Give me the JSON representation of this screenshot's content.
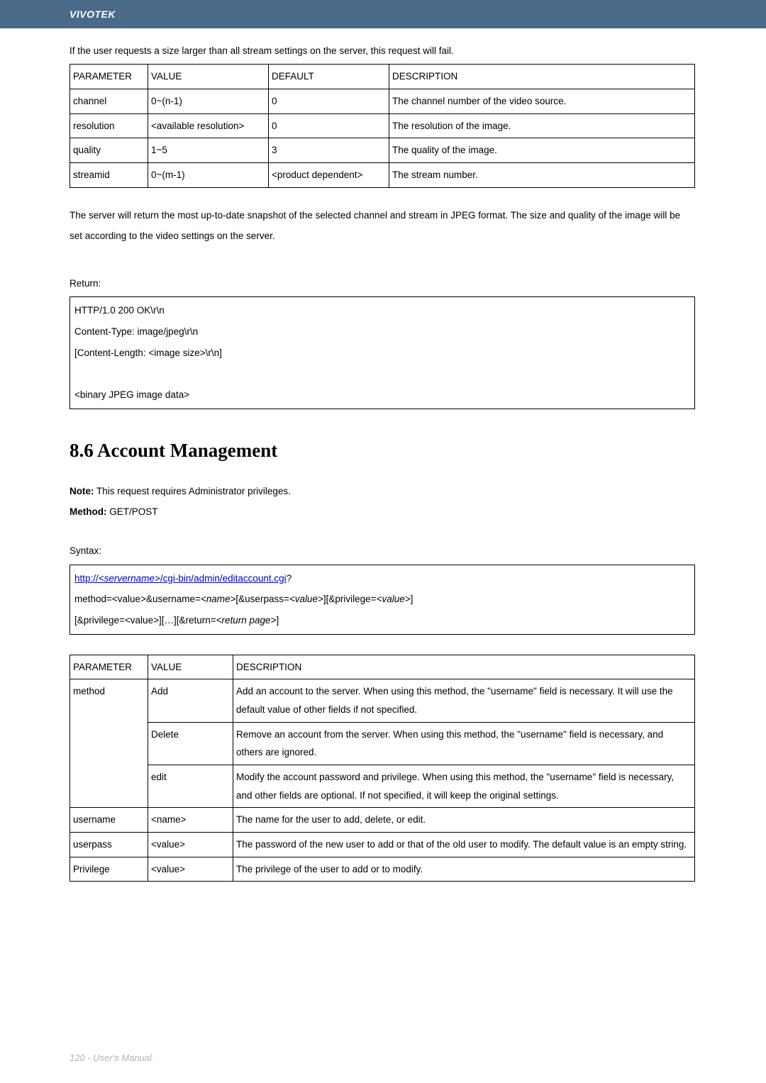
{
  "header": {
    "brand": "VIVOTEK"
  },
  "intro": "If the user requests a size larger than all stream settings on the server, this request will fail.",
  "table1": {
    "headers": [
      "PARAMETER",
      "VALUE",
      "DEFAULT",
      "DESCRIPTION"
    ],
    "rows": [
      {
        "param": "channel",
        "value": "0~(n-1)",
        "default": "0",
        "desc": "The channel number of the video source."
      },
      {
        "param": "resolution",
        "value": "<available resolution>",
        "default": "0",
        "desc": "The resolution of the image."
      },
      {
        "param": "quality",
        "value": "1~5",
        "default": "3",
        "desc": "The quality of the image."
      },
      {
        "param": "streamid",
        "value": "0~(m-1)",
        "default": "<product dependent>",
        "desc": "The stream number."
      }
    ]
  },
  "para": "The server will return the most up-to-date snapshot of the selected channel and stream in JPEG format. The size and quality of the image will be set according to the video settings on the server.",
  "return_label": "Return:",
  "return_lines": [
    "HTTP/1.0 200 OK\\r\\n",
    "Content-Type: image/jpeg\\r\\n",
    "[Content-Length: <image size>\\r\\n]",
    "",
    "<binary JPEG image data>"
  ],
  "section_title": "8.6 Account Management",
  "note": {
    "label": "Note:",
    "text": " This request requires Administrator privileges."
  },
  "method": {
    "label": "Method:",
    "text": " GET/POST"
  },
  "syntax_label": "Syntax:",
  "syntax": {
    "link_prefix": "http://",
    "link_servername": "<servername>",
    "link_path": "/cgi-bin/admin/editaccount.cgi",
    "link_suffix": "?",
    "line2_a": "method=<value>&username=",
    "line2_name": "<name>",
    "line2_b": "[&userpass=",
    "line2_val1": "<value>",
    "line2_c": "][&privilege=",
    "line2_val2": "<value>",
    "line2_d": "]",
    "line3_a": "[&privilege=<value>][…][&return=",
    "line3_ret": "<return page>",
    "line3_b": "]"
  },
  "table2": {
    "headers": [
      "PARAMETER",
      "VALUE",
      "DESCRIPTION"
    ],
    "rows": [
      {
        "param": "method",
        "value": "Add",
        "desc": "Add an account to the server. When using this method, the \"username\" field is necessary. It will use the default value of other fields if not specified."
      },
      {
        "param": "",
        "value": "Delete",
        "desc": "Remove an account from the server. When using this method, the \"username\" field is necessary, and others are ignored."
      },
      {
        "param": "",
        "value": "edit",
        "desc": "Modify the account password and privilege. When using this method, the \"username\" field is necessary, and other fields are optional. If not specified, it will keep the original settings."
      },
      {
        "param": "username",
        "value": "<name>",
        "desc": "The name for the user to add, delete, or edit."
      },
      {
        "param": "userpass",
        "value": "<value>",
        "desc": "The password of the new user to add or that of the old user to modify. The default value is an empty string."
      },
      {
        "param": "Privilege",
        "value": "<value>",
        "desc": "The privilege of the user to add or to modify."
      }
    ]
  },
  "footer": "120 - User's Manual"
}
